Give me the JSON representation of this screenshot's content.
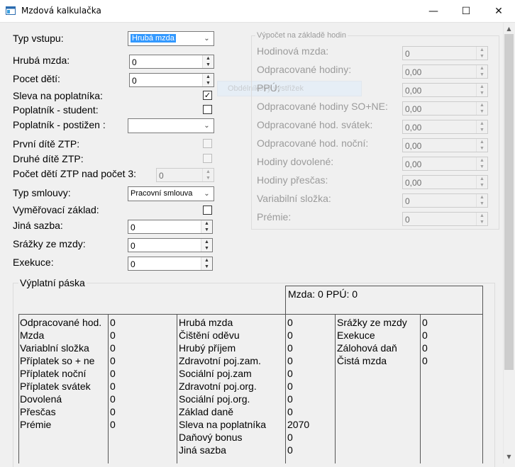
{
  "window": {
    "title": "Mzdová kalkulačka",
    "controls": {
      "minimize": "—",
      "maximize": "☐",
      "close": "✕"
    }
  },
  "form": {
    "typ_vstupu": {
      "label": "Typ vstupu:",
      "value": "Hrubá mzda"
    },
    "hruba_mzda": {
      "label": "Hrubá mzda:",
      "value": "0"
    },
    "pocet_deti": {
      "label": "Pocet dětí:",
      "value": "0"
    },
    "sleva_poplatnika": {
      "label": "Sleva na poplatníka:",
      "checked": true
    },
    "poplatnik_student": {
      "label": "Poplatník - student:",
      "checked": false
    },
    "poplatnik_postizen": {
      "label": "Poplatník - postižen  :",
      "value": ""
    },
    "prvni_dite_ztp": {
      "label": "První dítě ZTP:",
      "checked": false
    },
    "druhe_dite_ztp": {
      "label": "Druhé dítě ZTP:",
      "checked": false
    },
    "pocet_deti_ztp": {
      "label": "Počet dětí ZTP nad počet 3:",
      "value": "0"
    },
    "typ_smlouvy": {
      "label": "Typ smlouvy:",
      "value": "Pracovní smlouva"
    },
    "vymerovaci_zaklad": {
      "label": "Vyměřovací základ:",
      "checked": false
    },
    "jina_sazba": {
      "label": "Jiná sazba:",
      "value": "0"
    },
    "srazky_ze_mzdy": {
      "label": "Srážky ze mzdy:",
      "value": "0"
    },
    "exekuce": {
      "label": "Exekuce:",
      "value": "0"
    }
  },
  "hours_group": {
    "title": "Výpočet na základě hodin",
    "fields": [
      {
        "label": "Hodinová mzda:",
        "value": "0"
      },
      {
        "label": "Odpracované hodiny:",
        "value": "0,00"
      },
      {
        "label": "PPÚ:",
        "value": "0,00"
      },
      {
        "label": "Odpracované hodiny SO+NE:",
        "value": "0,00"
      },
      {
        "label": "Odpracované hod. svátek:",
        "value": "0,00"
      },
      {
        "label": "Odpracované hod. noční:",
        "value": "0,00"
      },
      {
        "label": "Hodiny dovolené:",
        "value": "0,00"
      },
      {
        "label": "Hodiny přesčas:",
        "value": "0,00"
      },
      {
        "label": "Variabilní složka:",
        "value": "0"
      },
      {
        "label": "Prémie:",
        "value": "0"
      }
    ]
  },
  "ghost_button": {
    "label": "Obdélníkový výstřižek"
  },
  "payslip": {
    "title": "Výplatní páska",
    "header": "Mzda: 0  PPÚ: 0",
    "col1": [
      {
        "label": "Odpracované hod.",
        "value": "0"
      },
      {
        "label": "Mzda",
        "value": "0"
      },
      {
        "label": "Variablní složka",
        "value": "0"
      },
      {
        "label": "Příplatek so + ne",
        "value": "0"
      },
      {
        "label": "Příplatek noční",
        "value": "0"
      },
      {
        "label": "Příplatek svátek",
        "value": "0"
      },
      {
        "label": "Dovolená",
        "value": "0"
      },
      {
        "label": "Přesčas",
        "value": "0"
      },
      {
        "label": "Prémie",
        "value": "0"
      }
    ],
    "col2": [
      {
        "label": "Hrubá mzda",
        "value": "0"
      },
      {
        "label": "Čištění oděvu",
        "value": "0"
      },
      {
        "label": "Hrubý příjem",
        "value": "0"
      },
      {
        "label": "Zdravotní poj.zam.",
        "value": "0"
      },
      {
        "label": "Sociální poj.zam",
        "value": "0"
      },
      {
        "label": "Zdravotní poj.org.",
        "value": "0"
      },
      {
        "label": "Sociální poj.org.",
        "value": "0"
      },
      {
        "label": "Základ daně",
        "value": "0"
      },
      {
        "label": "Sleva na poplatníka",
        "value": "2070"
      },
      {
        "label": "Daňový bonus",
        "value": "0"
      },
      {
        "label": "Jiná sazba",
        "value": "0"
      }
    ],
    "col3": [
      {
        "label": "Srážky ze mzdy",
        "value": "0"
      },
      {
        "label": "Exekuce",
        "value": "0"
      },
      {
        "label": "Zálohová daň",
        "value": "0"
      },
      {
        "label": "Čistá mzda",
        "value": "0"
      }
    ]
  },
  "colors": {
    "selection": "#3399ff",
    "window_bg": "#f0f0f0",
    "disabled_text": "#9b9b9b"
  }
}
